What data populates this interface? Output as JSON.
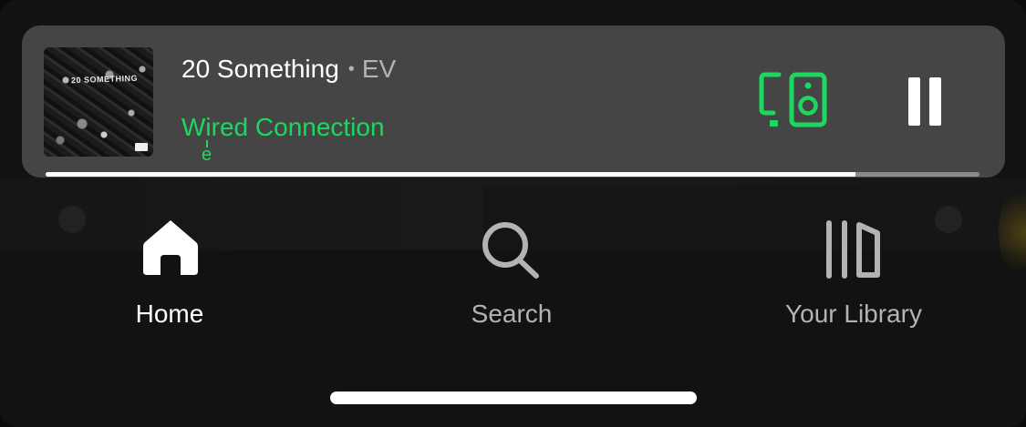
{
  "mini_player": {
    "track_title": "20 Something",
    "separator": "•",
    "artist": "EV",
    "device": "Wired Connection",
    "device_mark": "e",
    "album_art_text": "20 SOMETHING",
    "progress_fraction": 0.867,
    "connect_icon": "connect-devices-icon",
    "pause_icon": "pause-icon"
  },
  "nav": {
    "tabs": [
      {
        "label": "Home",
        "icon": "home-icon",
        "active": true
      },
      {
        "label": "Search",
        "icon": "search-icon",
        "active": false
      },
      {
        "label": "Your Library",
        "icon": "library-icon",
        "active": false
      }
    ]
  },
  "colors": {
    "accent": "#1ed760",
    "player_bg": "#454545",
    "background": "#121212",
    "inactive_text": "#b3b3b3"
  }
}
